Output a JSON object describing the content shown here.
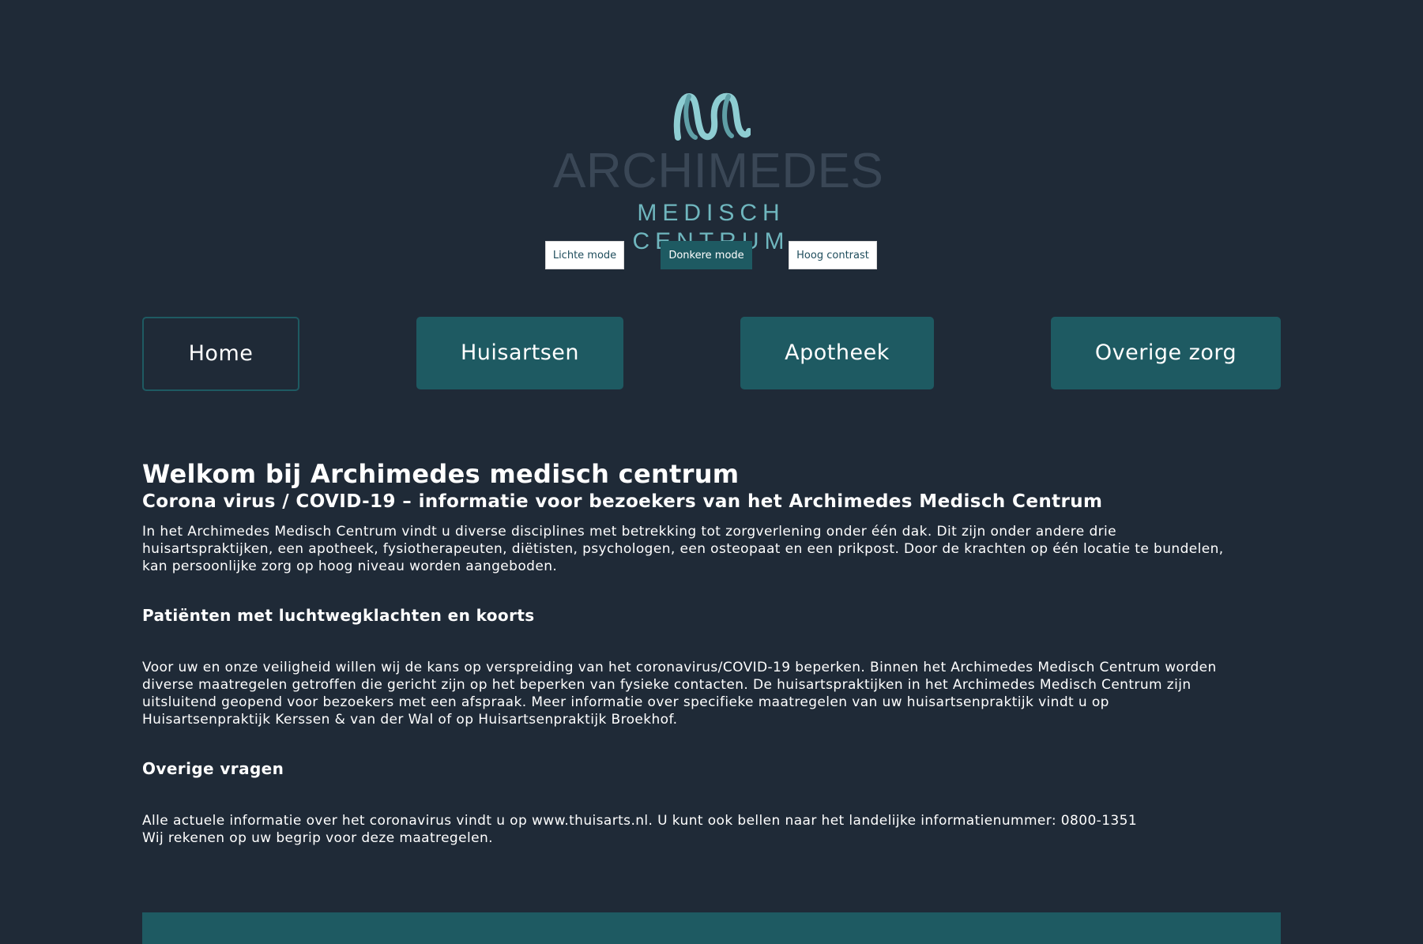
{
  "logo": {
    "wordmark": "ARCHIMEDES",
    "subtitle": "MEDISCH CENTRUM",
    "colors": {
      "mark": "#8ecdd2",
      "wordmark": "#3a4756",
      "subtitle": "#6fb6be"
    }
  },
  "display_modes": {
    "light": "Lichte mode",
    "dark": "Donkere mode",
    "contrast": "Hoog contrast",
    "active": "dark"
  },
  "nav": {
    "home": "Home",
    "huisartsen": "Huisartsen",
    "apotheek": "Apotheek",
    "overige_zorg": "Overige zorg",
    "active": "home"
  },
  "content": {
    "title": "Welkom bij Archimedes medisch centrum",
    "subtitle": "Corona virus / COVID-19 – informatie voor bezoekers van het Archimedes Medisch Centrum",
    "intro": "In het Archimedes Medisch Centrum vindt u diverse disciplines met betrekking tot zorgverlening onder één dak. Dit zijn onder andere drie huisartspraktijken, een apotheek, fysiotherapeuten, diëtisten, psychologen, een osteopaat en een prikpost. Door de krachten op één locatie te bundelen, kan persoonlijke zorg op hoog niveau worden aangeboden.",
    "section1_heading": "Patiënten met luchtwegklachten en koorts",
    "section1_text": "Voor uw en onze veiligheid willen wij de kans op verspreiding van het coronavirus/COVID-19 beperken. Binnen het Archimedes Medisch Centrum worden diverse maatregelen getroffen die gericht zijn op het beperken van fysieke contacten. De huisartspraktijken in het Archimedes Medisch Centrum zijn uitsluitend geopend voor bezoekers met een afspraak. Meer informatie over specifieke maatregelen van uw huisartsenpraktijk vindt u op Huisartsenpraktijk Kerssen & van der Wal of op Huisartsenpraktijk Broekhof.",
    "section2_heading": "Overige vragen",
    "section2_line1": "Alle actuele informatie over het coronavirus vindt u op www.thuisarts.nl. U kunt ook bellen naar het landelijke informatienummer: 0800-1351",
    "section2_line2": "Wij rekenen op uw begrip voor deze maatregelen."
  },
  "colors": {
    "background": "#1f2a37",
    "accent": "#1e5a62",
    "text": "#ffffff"
  }
}
